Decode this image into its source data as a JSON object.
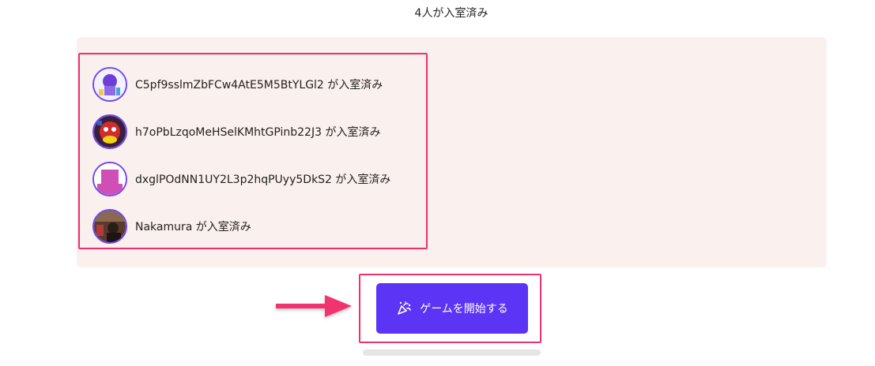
{
  "header": {
    "joined_count_text": "4人が入室済み"
  },
  "members": [
    {
      "name": "C5pf9sslmZbFCw4AtE5M5BtYLGl2",
      "status_text": "C5pf9sslmZbFCw4AtE5M5BtYLGl2 が入室済み",
      "avatar_icon": "illustration-avatar-icon"
    },
    {
      "name": "h7oPbLzqoMeHSelKMhtGPinb22J3",
      "status_text": "h7oPbLzqoMeHSelKMhtGPinb22J3 が入室済み",
      "avatar_icon": "character-avatar-icon"
    },
    {
      "name": "dxglPOdNN1UY2L3p2hqPUyy5DkS2",
      "status_text": "dxglPOdNN1UY2L3p2hqPUyy5DkS2 が入室済み",
      "avatar_icon": "pink-square-avatar-icon"
    },
    {
      "name": "Nakamura",
      "status_text": "Nakamura が入室済み",
      "avatar_icon": "photo-avatar-icon"
    }
  ],
  "actions": {
    "start_game_label": "ゲームを開始する",
    "start_game_icon": "party-popper-icon"
  },
  "colors": {
    "panel_bg": "#faf0ee",
    "accent": "#5b34f5",
    "avatar_border": "#6f48f3",
    "annotation": "#f02f6e"
  }
}
